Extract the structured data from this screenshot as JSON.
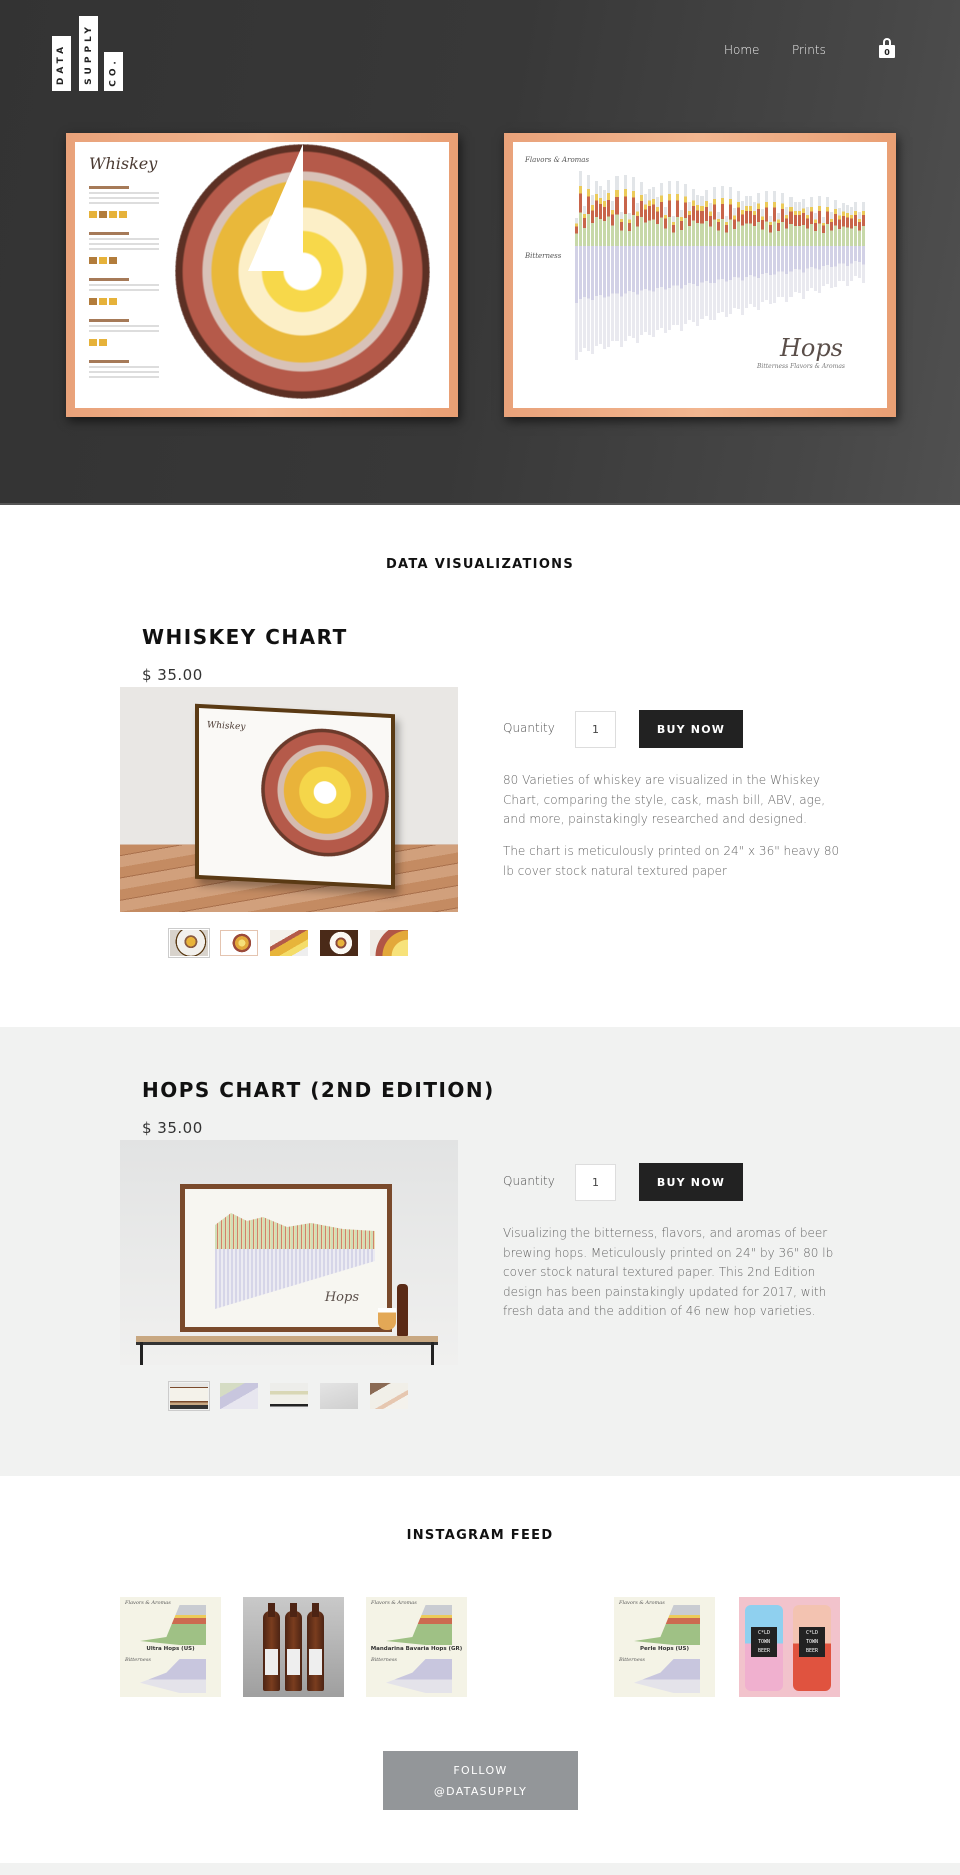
{
  "brand": {
    "logo_words": [
      "DATA",
      "SUPPLY",
      "CO."
    ]
  },
  "nav": {
    "items": [
      {
        "label": "Home"
      },
      {
        "label": "Prints"
      }
    ],
    "cart_count": "0"
  },
  "hero": {
    "posters": [
      {
        "title": "Whiskey",
        "kind": "whiskey-poster"
      },
      {
        "title": "Hops",
        "subtitle": "Bitterness  Flavors & Aromas",
        "section_a": "Flavors & Aromas",
        "section_b": "Bitterness",
        "kind": "hops-poster"
      }
    ]
  },
  "section_title": "DATA VISUALIZATIONS",
  "products": [
    {
      "title": "WHISKEY CHART",
      "price": "$ 35.00",
      "image_poster_title": "Whiskey",
      "quantity_label": "Quantity",
      "quantity_value": "1",
      "buy_label": "BUY NOW",
      "description": [
        "80 Varieties of whiskey are visualized in the Whiskey Chart, comparing the style, cask, mash bill, ABV, age, and more, painstakingly researched and designed.",
        "The chart is meticulously printed on 24\" x 36\" heavy 80 lb cover stock natural textured paper"
      ],
      "thumbnails": [
        "whiskey-framed-wall",
        "whiskey-poster-flat",
        "whiskey-detail-closeup",
        "whiskey-dark-frame",
        "whiskey-ring-detail"
      ],
      "active_thumbnail": 0
    },
    {
      "title": "HOPS CHART (2ND EDITION)",
      "price": "$ 35.00",
      "image_poster_title": "Hops",
      "quantity_label": "Quantity",
      "quantity_value": "1",
      "buy_label": "BUY NOW",
      "description": [
        "Visualizing the bitterness, flavors, and aromas of beer brewing hops. Meticulously printed on 24\" by 36\" 80 lb cover stock natural textured paper. This 2nd Edition design has been painstakingly updated for 2017, with fresh data and the addition of 46 new hop varieties."
      ],
      "thumbnails": [
        "hops-framed-table",
        "hops-angle-detail",
        "hops-flat-print",
        "hops-logo-closeup",
        "hops-corner-detail"
      ],
      "active_thumbnail": 0
    }
  ],
  "instagram": {
    "title": "INSTAGRAM FEED",
    "posts": [
      {
        "kind": "hop-card",
        "heading_a": "Flavors & Aromas",
        "hop_name": "Ultra Hops (US)",
        "heading_b": "Bitterness"
      },
      {
        "kind": "bottles"
      },
      {
        "kind": "hop-card",
        "heading_a": "Flavors & Aromas",
        "hop_name": "Mandarina Bavaria Hops (GR)",
        "heading_b": "Bitterness"
      },
      {
        "kind": "empty"
      },
      {
        "kind": "hop-card",
        "heading_a": "Flavors & Aromas",
        "hop_name": "Perle Hops (US)",
        "heading_b": "Bitterness"
      },
      {
        "kind": "cans",
        "can_text": "C*LD TOWN BEER"
      }
    ],
    "follow_label_line1": "FOLLOW",
    "follow_label_line2": "@DATASUPPLY"
  },
  "colors": {
    "hero_bg": "#383838",
    "buy_button": "#222222",
    "follow_button": "#939699",
    "grey_band": "#f1f2f1"
  }
}
